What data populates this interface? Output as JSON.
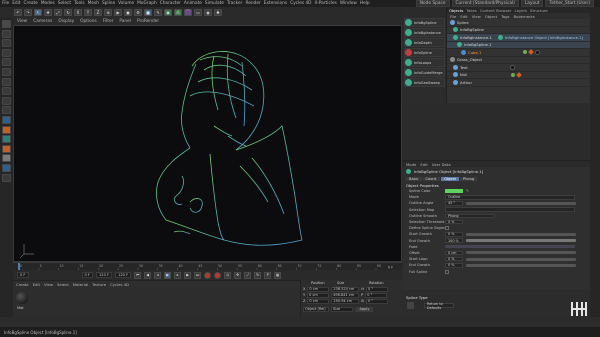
{
  "menubar": {
    "items": [
      "File",
      "Edit",
      "Create",
      "Modes",
      "Select",
      "Tools",
      "Mesh",
      "Spline",
      "Volume",
      "MoGraph",
      "Character",
      "Animate",
      "Simulate",
      "Tracker",
      "Render",
      "Extensions",
      "Cycles 4D",
      "X-Particles",
      "Window",
      "Help"
    ],
    "node_space_label": "Node Space",
    "node_space_value": "Current (Standard/Physical)",
    "layout_label": "Layout",
    "layout_value": "Tether_Start (User)"
  },
  "toolbar": {
    "icons": [
      "undo-icon",
      "redo-icon",
      "live-selection-icon",
      "move-icon",
      "scale-icon",
      "rotate-icon",
      "x-axis-icon",
      "y-axis-icon",
      "z-axis-icon",
      "coordinate-system-icon",
      "render-view-icon",
      "render-picture-viewer-icon",
      "edit-render-settings-icon",
      "cube-icon",
      "pen-icon",
      "subdivision-icon",
      "array-icon",
      "bend-icon",
      "floor-icon",
      "camera-icon",
      "light-icon"
    ]
  },
  "viewport": {
    "menu": [
      "View",
      "Cameras",
      "Display",
      "Options",
      "Filter",
      "Panel",
      "ProRender"
    ]
  },
  "plugin_toolbar": {
    "items": [
      "InfoBgSpline",
      "InfoBgInstance",
      "InfoDepth",
      "InfoSpline",
      "InfoLoops",
      "InfoGuideMerge",
      "InfoGeoSweep"
    ]
  },
  "object_manager": {
    "tabs": [
      "Objects",
      "Takes",
      "Content Browser",
      "Layers",
      "Structure"
    ],
    "menu": [
      "File",
      "Edit",
      "View",
      "Object",
      "Tags",
      "Bookmarks"
    ],
    "rows": [
      {
        "name": "Spline",
        "indent": 0
      },
      {
        "name": "InfoBgSpline",
        "indent": 1
      },
      {
        "name": "InfoBgInstance.1",
        "indent": 1,
        "note": "InfoBgInstance Object [InfoBgInstance.1]"
      },
      {
        "name": "InfoBgSpline.1",
        "indent": 2
      },
      {
        "name": "Cube.1",
        "indent": 3
      },
      {
        "name": "Grass_Object",
        "indent": 0
      },
      {
        "name": "Text",
        "indent": 1
      },
      {
        "name": "Null",
        "indent": 1
      },
      {
        "name": "Arthur",
        "indent": 1
      }
    ]
  },
  "timeline": {
    "ticks": [
      "0",
      "5",
      "10",
      "15",
      "20",
      "25",
      "30",
      "35",
      "40",
      "45",
      "50",
      "55",
      "60",
      "65",
      "70",
      "75",
      "80",
      "85",
      "90"
    ],
    "end_label": "0 F"
  },
  "transport": {
    "start_frame": "0 F",
    "current_frame": "0 F",
    "end_frame": "120 F",
    "max_frame": "120 F"
  },
  "material_manager": {
    "menu": [
      "Create",
      "Edit",
      "View",
      "Select",
      "Material",
      "Texture",
      "Cycles 4D"
    ],
    "material_label": "Mat"
  },
  "coordinates": {
    "headers": [
      "Position",
      "Size",
      "Rotation"
    ],
    "rows": [
      {
        "axis": "X",
        "pos": "0 cm",
        "size": "238.524 cm",
        "rot_label": "H",
        "rot": "0 °"
      },
      {
        "axis": "Y",
        "pos": "0 cm",
        "size": "496.841 cm",
        "rot_label": "P",
        "rot": "0 °"
      },
      {
        "axis": "Z",
        "pos": "0 cm",
        "size": "250.94 cm",
        "rot_label": "B",
        "rot": "0 °"
      }
    ],
    "mode": "Object (Rel)",
    "size_mode": "Size",
    "apply_label": "Apply"
  },
  "attributes": {
    "menu": [
      "Mode",
      "Edit",
      "User Data"
    ],
    "title": "InfoBgSpline Object [InfoBgSpline.1]",
    "tabs": [
      "Basic",
      "Coord.",
      "Object",
      "Phong"
    ],
    "active_tab": "Object",
    "section": "Object Properties",
    "props": [
      {
        "label": "Spline Color",
        "value": ""
      },
      {
        "label": "Mode",
        "value": "Outline"
      },
      {
        "label": "Outline Angle",
        "value": "45 °"
      },
      {
        "label": "Selection Map",
        "value": ""
      },
      {
        "label": "Outline Smooth",
        "value": "Phong"
      },
      {
        "label": "Selection Threshold",
        "value": "0 %"
      },
      {
        "label": "Define Spline Segments",
        "value": ""
      },
      {
        "label": "Start Growth",
        "value": "0 %"
      },
      {
        "label": "End Growth",
        "value": "100 %"
      },
      {
        "label": "Fade",
        "value": ""
      },
      {
        "label": "Offset",
        "value": "0 cm"
      },
      {
        "label": "Start Loop",
        "value": "0 %"
      },
      {
        "label": "End Growth",
        "value": "0 %"
      },
      {
        "label": "Full Spline",
        "value": ""
      }
    ],
    "subsection": "Spline Type",
    "button": "Return to Defaults"
  },
  "status_bar": {
    "text": "InfoBgSpline Object [InfoBgSpline.1]"
  },
  "colors": {
    "accent": "#5b7aa3",
    "spline": "#3fae8e",
    "viewport_bg": "#0c0c0f",
    "swatch": "#5fd45f"
  }
}
